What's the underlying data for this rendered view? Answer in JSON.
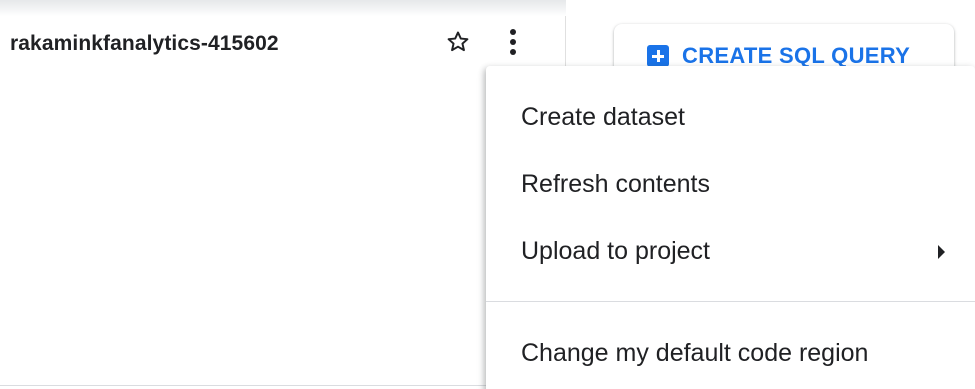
{
  "explorer": {
    "project_name": "rakaminkfanalytics-415602"
  },
  "toolbar": {
    "create_sql_query_label": "CREATE SQL QUERY",
    "accent_color": "#1a73e8"
  },
  "menu": {
    "items": [
      {
        "label": "Create dataset"
      },
      {
        "label": "Refresh contents"
      },
      {
        "label": "Upload to project",
        "has_submenu": true
      },
      {
        "label": "Change my default code region"
      }
    ]
  },
  "icons": {
    "star": "star-outline-icon",
    "more": "more-vert-icon",
    "add": "add-box-icon",
    "submenu": "arrow-right-icon"
  }
}
